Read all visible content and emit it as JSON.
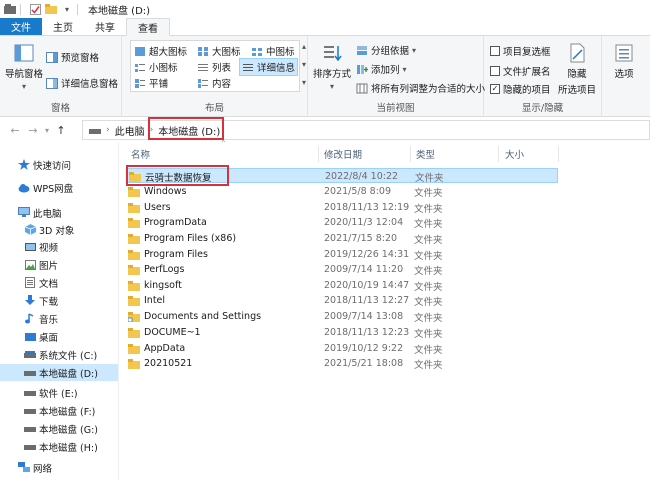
{
  "window": {
    "title": "本地磁盘 (D:)"
  },
  "ribbon_tabs": [
    "文件",
    "主页",
    "共享",
    "查看"
  ],
  "ribbon": {
    "pane": {
      "label": "窗格",
      "nav_pane": "导航窗格",
      "preview_pane": "预览窗格",
      "details_pane": "详细信息窗格"
    },
    "layout": {
      "label": "布局",
      "options": [
        "超大图标",
        "大图标",
        "中图标",
        "小图标",
        "列表",
        "详细信息",
        "平铺",
        "内容"
      ],
      "selected": "详细信息"
    },
    "current_view": {
      "label": "当前视图",
      "sort_by": "排序方式",
      "group_by": "分组依据",
      "add_columns": "添加列",
      "fit_columns": "将所有列调整为合适的大小"
    },
    "show_hide": {
      "label": "显示/隐藏",
      "item_checkboxes": "项目复选框",
      "file_extensions": "文件扩展名",
      "hidden_items": "隐藏的项目",
      "hide_selected": "隐藏",
      "hide_selected_2": "所选项目",
      "options": "选项"
    }
  },
  "address": {
    "back": "←",
    "forward": "→",
    "up": "↑",
    "crumbs": [
      "此电脑",
      "本地磁盘 (D:)"
    ]
  },
  "nav_pane": [
    {
      "label": "快速访问",
      "icon": "star-icon"
    },
    {
      "label": "WPS网盘",
      "icon": "cloud-icon"
    },
    {
      "label": "此电脑",
      "icon": "computer-icon"
    },
    {
      "label": "3D 对象",
      "icon": "cube-icon"
    },
    {
      "label": "视频",
      "icon": "video-icon"
    },
    {
      "label": "图片",
      "icon": "picture-icon"
    },
    {
      "label": "文档",
      "icon": "document-icon"
    },
    {
      "label": "下载",
      "icon": "download-icon"
    },
    {
      "label": "音乐",
      "icon": "music-icon"
    },
    {
      "label": "桌面",
      "icon": "desktop-icon"
    },
    {
      "label": "系统文件 (C:)",
      "icon": "drive-icon"
    },
    {
      "label": "本地磁盘 (D:)",
      "icon": "drive-icon",
      "selected": true
    },
    {
      "label": "软件 (E:)",
      "icon": "drive-icon"
    },
    {
      "label": "本地磁盘 (F:)",
      "icon": "drive-icon"
    },
    {
      "label": "本地磁盘 (G:)",
      "icon": "drive-icon"
    },
    {
      "label": "本地磁盘 (H:)",
      "icon": "drive-icon"
    },
    {
      "label": "网络",
      "icon": "network-icon"
    }
  ],
  "columns": [
    "名称",
    "修改日期",
    "类型",
    "大小"
  ],
  "files": [
    {
      "name": "云骑士数据恢复",
      "date": "2022/8/4 10:22",
      "type": "文件夹",
      "selected": true
    },
    {
      "name": "Windows",
      "date": "2021/5/8 8:09",
      "type": "文件夹"
    },
    {
      "name": "Users",
      "date": "2018/11/13 12:19",
      "type": "文件夹"
    },
    {
      "name": "ProgramData",
      "date": "2020/11/3 12:04",
      "type": "文件夹"
    },
    {
      "name": "Program Files (x86)",
      "date": "2021/7/15 8:20",
      "type": "文件夹"
    },
    {
      "name": "Program Files",
      "date": "2019/12/26 14:31",
      "type": "文件夹"
    },
    {
      "name": "PerfLogs",
      "date": "2009/7/14 11:20",
      "type": "文件夹"
    },
    {
      "name": "kingsoft",
      "date": "2020/10/19 14:47",
      "type": "文件夹"
    },
    {
      "name": "Intel",
      "date": "2018/11/13 12:27",
      "type": "文件夹"
    },
    {
      "name": "Documents and Settings",
      "date": "2009/7/14 13:08",
      "type": "文件夹"
    },
    {
      "name": "DOCUME~1",
      "date": "2018/11/13 12:23",
      "type": "文件夹"
    },
    {
      "name": "AppData",
      "date": "2019/10/12 9:22",
      "type": "文件夹"
    },
    {
      "name": "20210521",
      "date": "2021/5/21 18:08",
      "type": "文件夹"
    }
  ],
  "colors": {
    "accent": "#1979ca",
    "selection": "#cce8ff",
    "highlight_box": "#d9303c",
    "folder": "#f3c74f"
  }
}
